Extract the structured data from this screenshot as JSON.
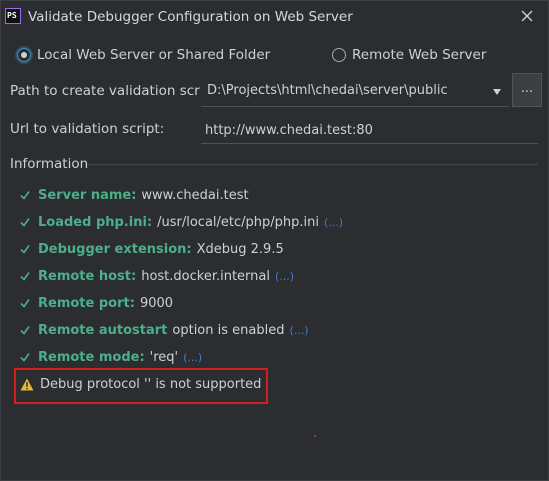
{
  "dialog": {
    "app_icon_text": "PS",
    "title": "Validate Debugger Configuration on Web Server"
  },
  "mode": {
    "local_label": "Local Web Server or Shared Folder",
    "remote_label": "Remote Web Server",
    "selected": "local"
  },
  "path": {
    "label": "Path to create validation script:",
    "value": "D:\\Projects\\html\\chedai\\server\\public",
    "browse_label": "..."
  },
  "url": {
    "label": "Url to validation script:",
    "value": "http://www.chedai.test:80"
  },
  "info": {
    "title": "Information",
    "status_color": "#4bb08a",
    "link_color": "#3d7fd6",
    "items": [
      {
        "key": "Server name:",
        "value": "www.chedai.test",
        "more": ""
      },
      {
        "key": "Loaded php.ini:",
        "value": "/usr/local/etc/php/php.ini",
        "more": "(...)"
      },
      {
        "key": "Debugger extension:",
        "value": "Xdebug 2.9.5",
        "more": ""
      },
      {
        "key": "Remote host:",
        "value": "host.docker.internal",
        "more": "(...)"
      },
      {
        "key": "Remote port:",
        "value": "9000",
        "more": ""
      },
      {
        "key": "Remote autostart",
        "value": "option is enabled",
        "more": "(...)"
      },
      {
        "key": "Remote mode:",
        "value": "'req'",
        "more": "(...)"
      }
    ],
    "warning": {
      "icon": "warning-icon",
      "text": "Debug protocol '' is not supported",
      "highlight_color": "#d21e1e"
    }
  }
}
